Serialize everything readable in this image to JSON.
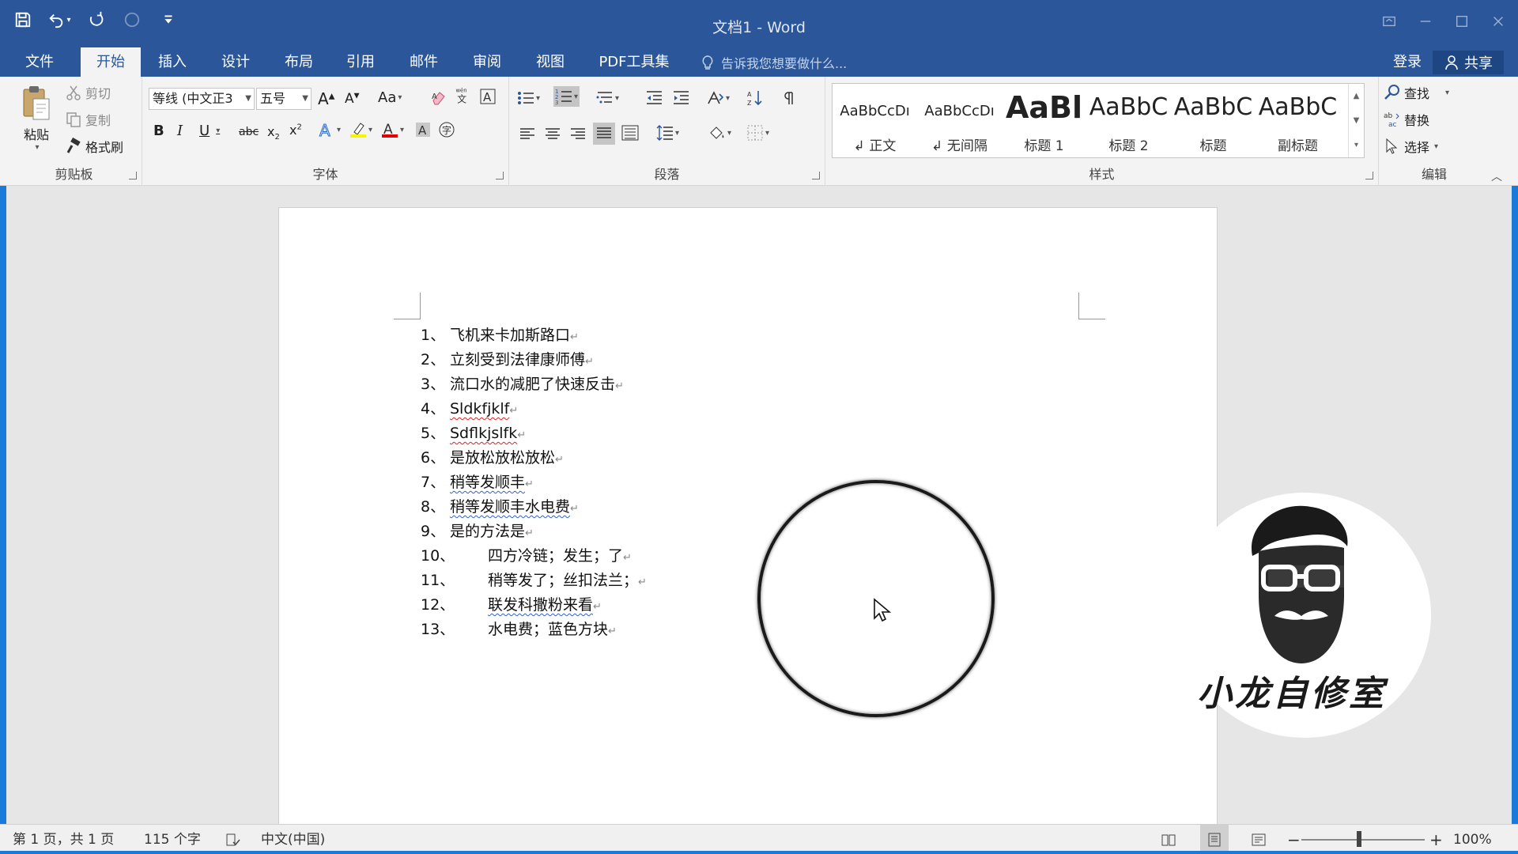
{
  "window": {
    "title": "文档1 - Word"
  },
  "tabs": [
    "文件",
    "开始",
    "插入",
    "设计",
    "布局",
    "引用",
    "邮件",
    "审阅",
    "视图",
    "PDF工具集"
  ],
  "tell_me": "告诉我您想要做什么...",
  "account": {
    "login": "登录",
    "share": "共享"
  },
  "clipboard": {
    "paste": "粘贴",
    "cut": "剪切",
    "copy": "复制",
    "format_painter": "格式刷",
    "label": "剪贴板"
  },
  "font": {
    "name": "等线 (中文正3",
    "size": "五号",
    "label": "字体",
    "change_case": "Aa"
  },
  "paragraph": {
    "label": "段落"
  },
  "styles": {
    "label": "样式",
    "items": [
      {
        "preview": "AaBbCcDı",
        "name": "↲ 正文"
      },
      {
        "preview": "AaBbCcDı",
        "name": "↲ 无间隔"
      },
      {
        "preview": "AaBl",
        "name": "标题 1"
      },
      {
        "preview": "AaBbC",
        "name": "标题 2"
      },
      {
        "preview": "AaBbC",
        "name": "标题"
      },
      {
        "preview": "AaBbC",
        "name": "副标题"
      }
    ]
  },
  "editing": {
    "find": "查找",
    "replace": "替换",
    "select": "选择",
    "label": "编辑"
  },
  "document": {
    "list": [
      {
        "num": "1、",
        "text": "飞机来卡加斯路口"
      },
      {
        "num": "2、",
        "text": "立刻受到法律康师傅"
      },
      {
        "num": "3、",
        "text": "流口水的减肥了快速反击"
      },
      {
        "num": "4、",
        "text": "Sldkfjklf"
      },
      {
        "num": "5、",
        "text": "Sdflkjslfk"
      },
      {
        "num": "6、",
        "text": "是放松放松放松"
      },
      {
        "num": "7、",
        "text": "稍等发顺丰"
      },
      {
        "num": "8、",
        "text": "稍等发顺丰水电费"
      },
      {
        "num": "9、",
        "text": "是的方法是"
      },
      {
        "num": "10、",
        "text": "四方冷链；发生；了"
      },
      {
        "num": "11、",
        "text": "稍等发了；丝扣法兰；"
      },
      {
        "num": "12、",
        "text": "联发科撒粉来看"
      },
      {
        "num": "13、",
        "text": "水电费；蓝色方块"
      }
    ],
    "paragraph_mark": "↵"
  },
  "watermark": {
    "text": "小龙自修室"
  },
  "status": {
    "page": "第 1 页，共 1 页",
    "words": "115 个字",
    "language": "中文(中国)",
    "zoom": "100%"
  }
}
